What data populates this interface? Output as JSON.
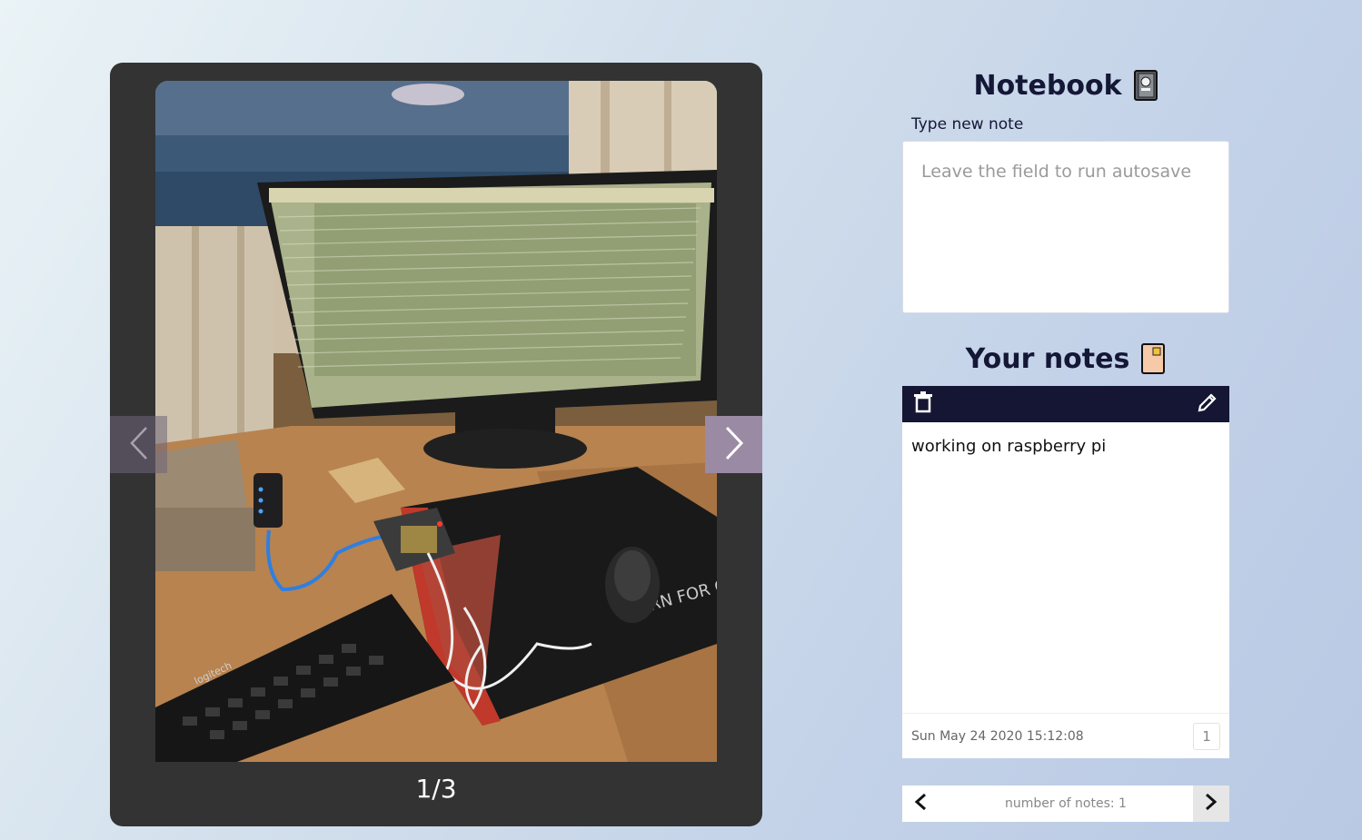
{
  "carousel": {
    "photo_alt": "desk with computer monitor, keyboard, mouse and raspberry pi",
    "counter": "1/3",
    "prev_icon": "chevron-left-icon",
    "next_icon": "chevron-right-icon"
  },
  "notebook": {
    "title": "Notebook",
    "title_emoji": "notebook-icon",
    "input_label": "Type new note",
    "input_placeholder": "Leave the field to run autosave",
    "input_value": ""
  },
  "your_notes": {
    "title": "Your notes",
    "title_emoji": "ledger-book-icon",
    "notes": [
      {
        "text": "working on raspberry pi",
        "date": "Sun May 24 2020 15:12:08",
        "index": "1"
      }
    ]
  },
  "pager": {
    "count_text": "number of notes: 1"
  },
  "colors": {
    "toolbar": "#141633",
    "heading": "#141736",
    "carousel_bg": "#333333",
    "next_arrow_bg": "#9b8aa3"
  }
}
